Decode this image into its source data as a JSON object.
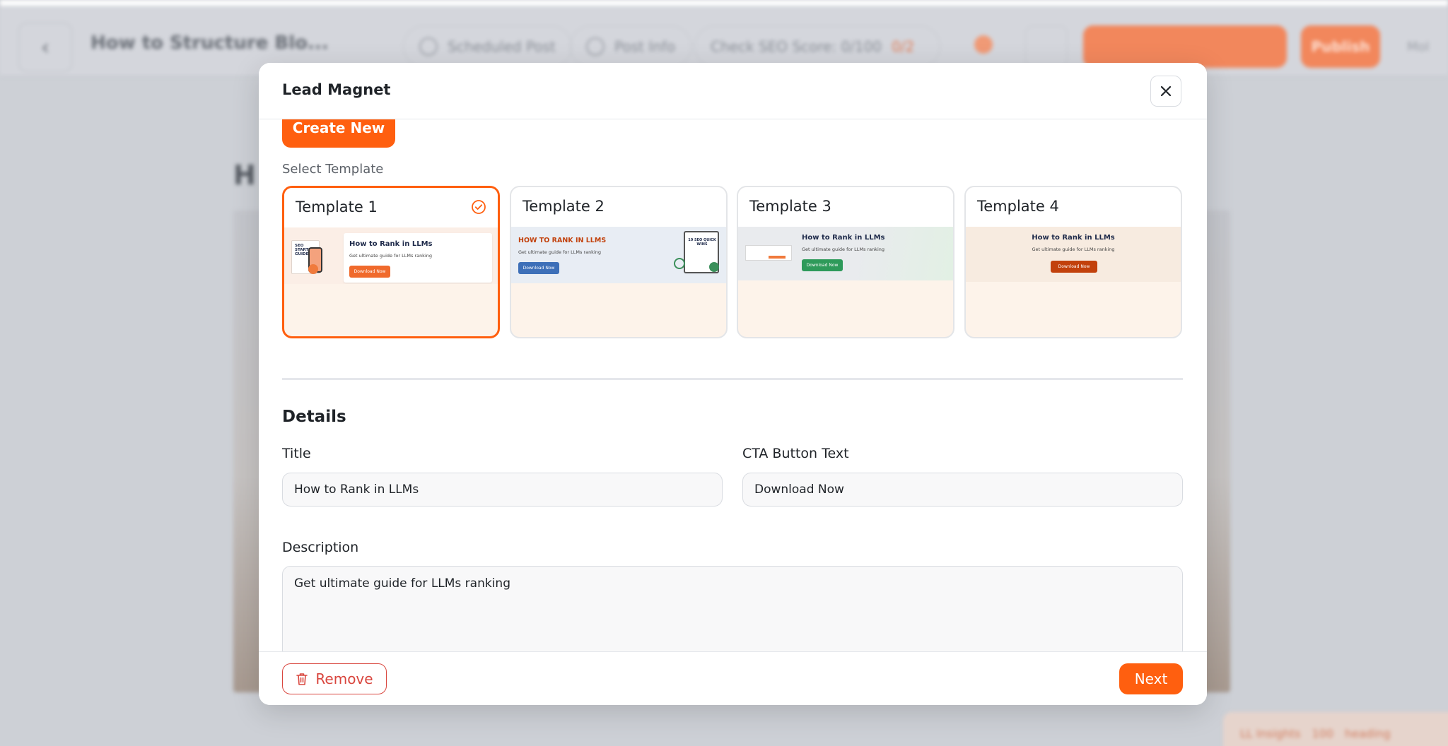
{
  "background": {
    "doc_title": "How to Structure Blo...",
    "heading": "H",
    "pills": [
      "Scheduled Post",
      "Post Info",
      "Check SEO Score: 0/100"
    ],
    "seo_badge": "0/2",
    "publish_label": "Publish",
    "more_label": "Mol",
    "bottom_badge_text": "LL Insights",
    "bottom_badge_count": "100",
    "bottom_badge_tail": "heading"
  },
  "modal": {
    "title": "Lead Magnet",
    "create_new_label": "Create New",
    "select_template_label": "Select Template",
    "templates": [
      {
        "name": "Template 1",
        "selected": true,
        "preview_title": "How to Rank in LLMs",
        "preview_desc": "Get ultimate guide for LLMs ranking",
        "preview_button": "Download Now",
        "book_text": "SEO STARTER GUIDE",
        "accent": "#ff5f0f"
      },
      {
        "name": "Template 2",
        "selected": false,
        "preview_title": "HOW TO RANK IN LLMS",
        "preview_desc": "Get ultimate guide for LLMs ranking",
        "preview_button": "Download Now",
        "clipboard_text": "10 SEO QUICK WINS",
        "accent": "#3d6fb8"
      },
      {
        "name": "Template 3",
        "selected": false,
        "preview_title": "How to Rank in LLMs",
        "preview_desc": "Get ultimate guide for LLMs ranking",
        "preview_button": "Download Now",
        "accent": "#2e9a5a"
      },
      {
        "name": "Template 4",
        "selected": false,
        "preview_title": "How to Rank in LLMs",
        "preview_desc": "Get ultimate guide for LLMs ranking",
        "preview_button": "Download Now",
        "accent": "#c2410c"
      }
    ],
    "details_heading": "Details",
    "title_label": "Title",
    "title_value": "How to Rank in LLMs",
    "cta_label": "CTA Button Text",
    "cta_value": "Download Now",
    "description_label": "Description",
    "description_value": "Get ultimate guide for LLMs ranking",
    "remove_label": "Remove",
    "next_label": "Next"
  },
  "colors": {
    "accent": "#ff5f0f",
    "danger": "#d9463e",
    "selected_border": "#ff5f0f"
  },
  "icons": {
    "close": "close-icon",
    "check": "check-circle-icon",
    "trash": "trash-icon",
    "back": "chevron-left-icon"
  }
}
